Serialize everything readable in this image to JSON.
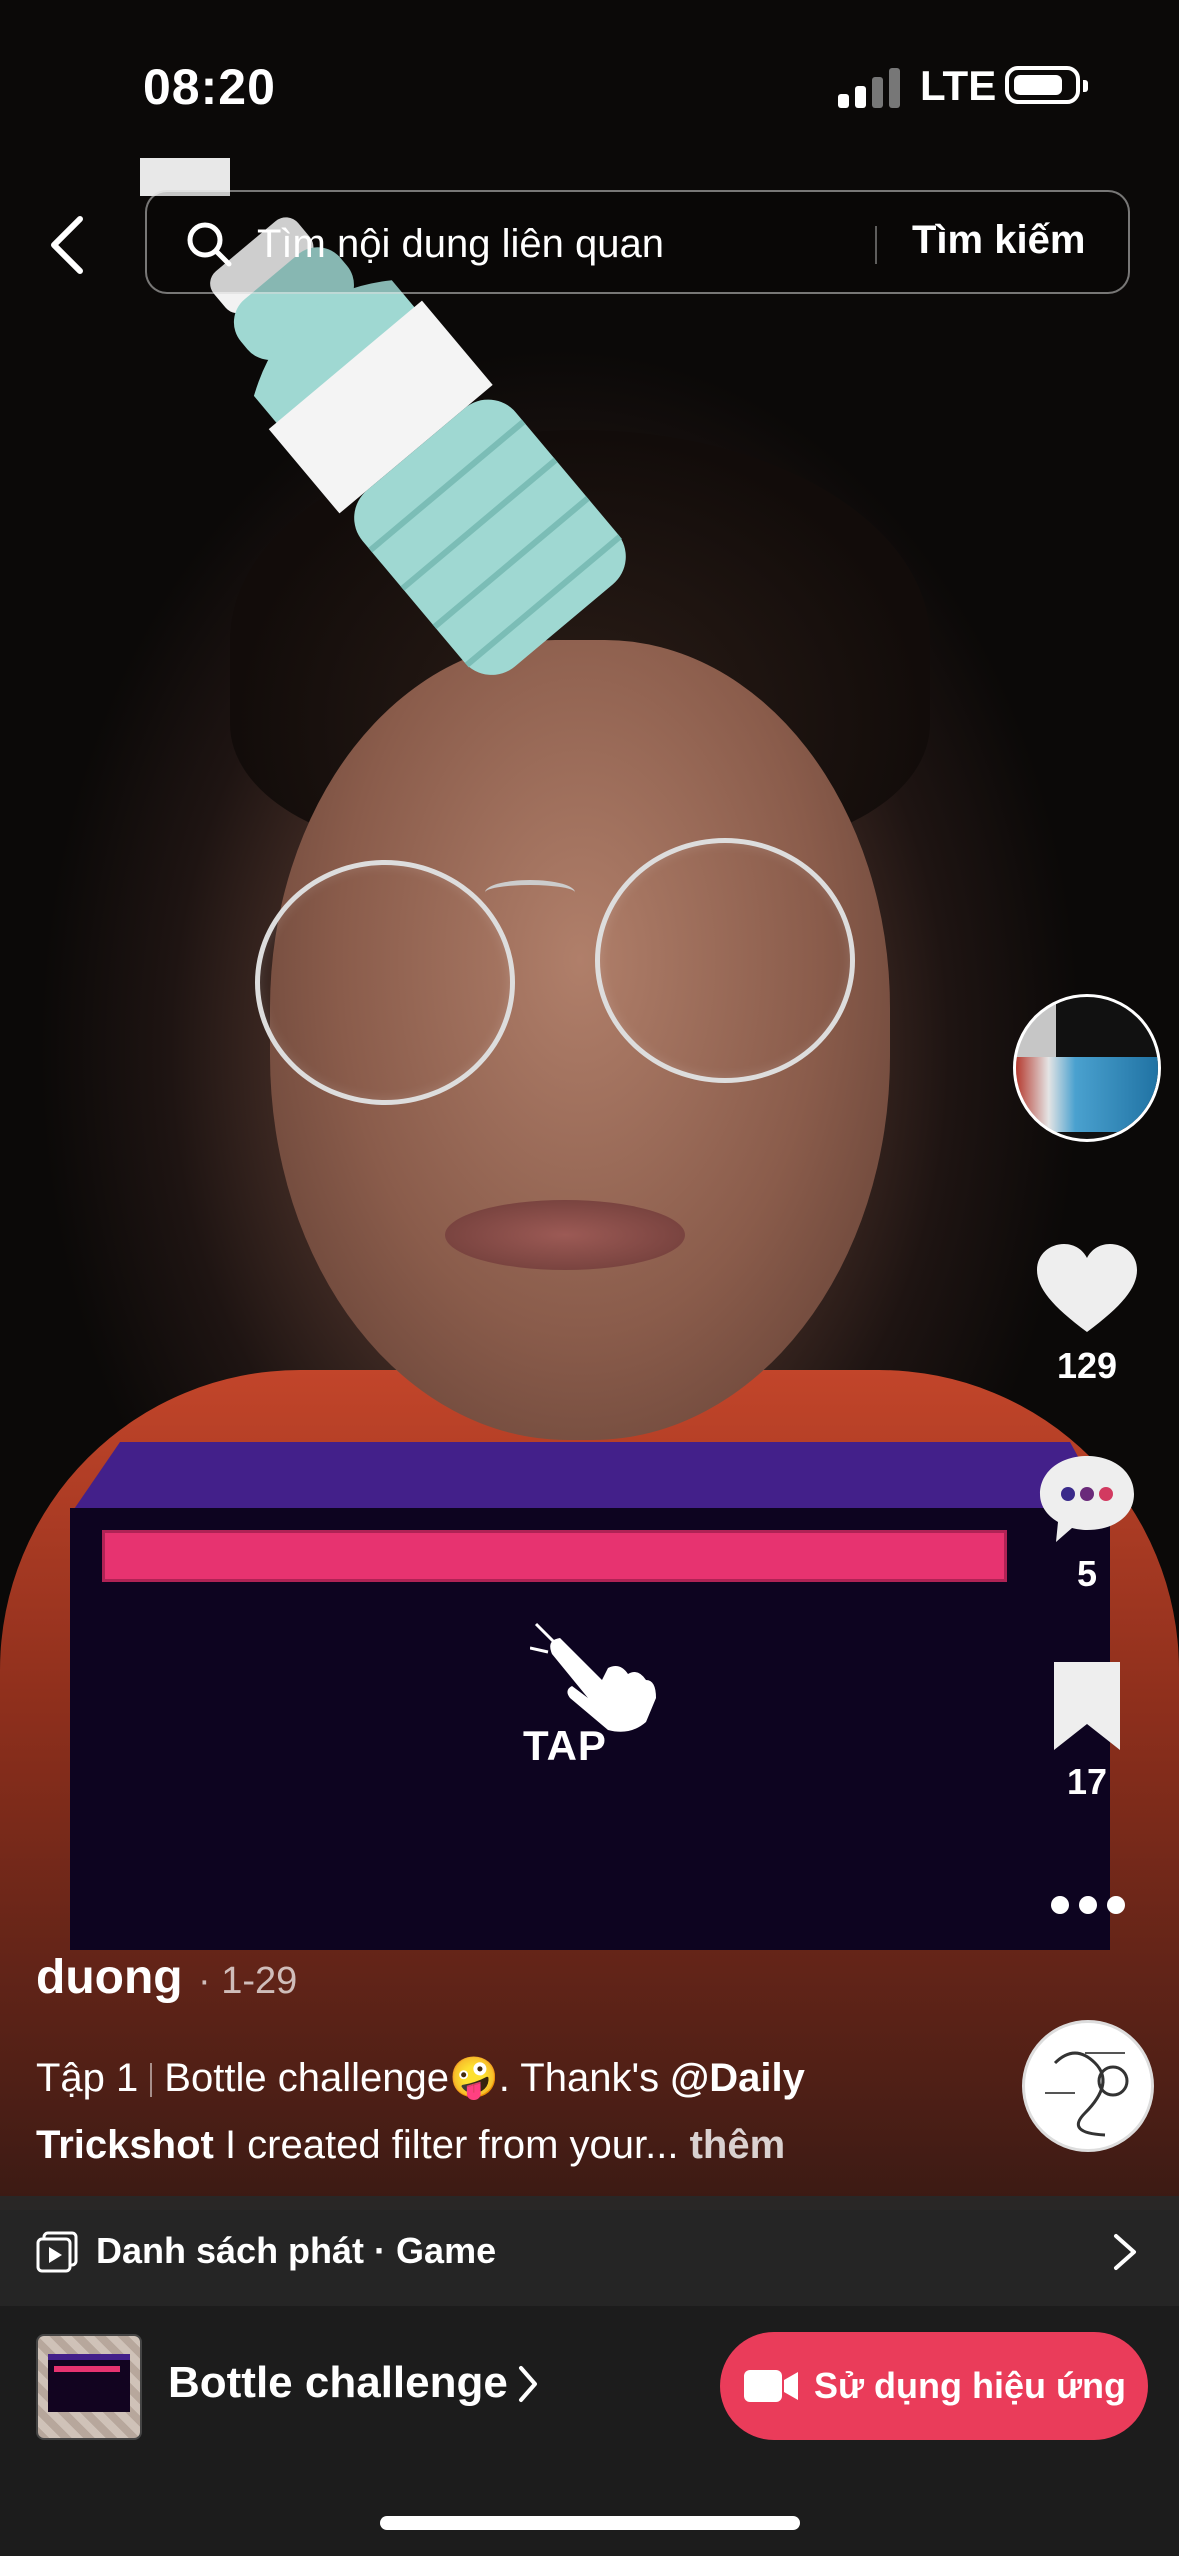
{
  "status_bar": {
    "time": "08:20",
    "network": "LTE",
    "battery_level": 0.8
  },
  "search": {
    "placeholder": "Tìm nội dung liên quan",
    "button_label": "Tìm kiếm"
  },
  "game": {
    "tap_label": "TAP"
  },
  "rail": {
    "likes": "129",
    "comments": "5",
    "saves": "17"
  },
  "post": {
    "author": "duong",
    "date": "· 1-29",
    "caption_episode": "Tập 1",
    "caption_title": "Bottle challenge",
    "caption_emoji": "🤪",
    "caption_thanks": ". Thank's ",
    "caption_mention": "@Daily Trickshot",
    "caption_rest": "  I created filter from your...",
    "caption_more": "thêm"
  },
  "playlist": {
    "label": "Danh sách phát · Game"
  },
  "effect": {
    "name": "Bottle challenge",
    "button_label": "Sử dụng hiệu ứng"
  },
  "icons": [
    "back-arrow-icon",
    "search-icon",
    "heart-icon",
    "comment-icon",
    "bookmark-icon",
    "more-dots-icon",
    "playlist-icon",
    "chevron-right-icon",
    "video-camera-icon",
    "tap-hand-icon"
  ],
  "colors": {
    "accent": "#ea3c5a",
    "game_bar": "#e73370",
    "game_box_top": "#43208a",
    "game_box_front": "#0d0420"
  }
}
